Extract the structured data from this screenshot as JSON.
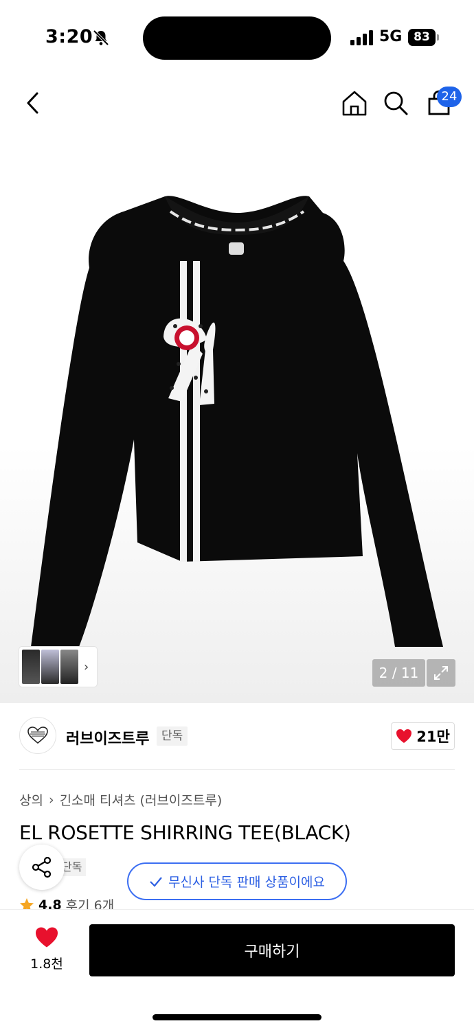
{
  "status_bar": {
    "time": "3:20",
    "network": "5G",
    "battery": "83"
  },
  "nav": {
    "cart_count": "24"
  },
  "gallery": {
    "counter": "2 / 11"
  },
  "brand": {
    "logo_text": "LOVEISTRUE",
    "name": "러브이즈트루",
    "exclusive_tag": "단독",
    "likes": "21만"
  },
  "breadcrumb": {
    "category": "상의",
    "sub_category": "긴소매 티셔츠 (러브이즈트루)"
  },
  "product": {
    "title": "EL ROSETTE SHIRRING TEE(BLACK)",
    "tag": "단독"
  },
  "toast": {
    "text": "무신사 단독 판매 상품이에요"
  },
  "rating": {
    "score": "4.8",
    "reviews": "후기 6개"
  },
  "bottom_bar": {
    "wish_count": "1.8천",
    "buy_label": "구매하기"
  },
  "colors": {
    "accent_blue": "#1e63e9",
    "heart_red": "#e8112d",
    "star": "#f5a623"
  }
}
